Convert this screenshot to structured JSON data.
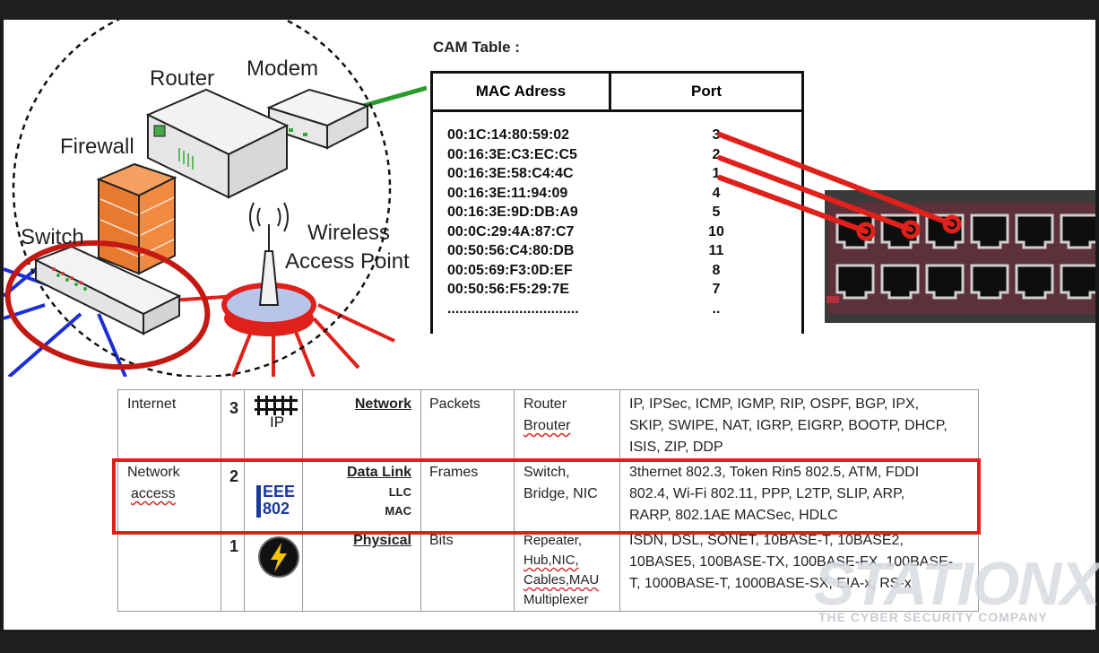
{
  "network_diagram": {
    "labels": {
      "router": "Router",
      "modem": "Modem",
      "firewall": "Firewall",
      "switch": "Switch",
      "wireless_line1": "Wireless",
      "wireless_line2": "Access Point"
    }
  },
  "cam_table": {
    "title": "CAM Table :",
    "headers": {
      "mac": "MAC Adress",
      "port": "Port"
    },
    "rows": [
      {
        "mac": "00:1C:14:80:59:02",
        "port": "3"
      },
      {
        "mac": "00:16:3E:C3:EC:C5",
        "port": "2"
      },
      {
        "mac": "00:16:3E:58:C4:4C",
        "port": "1"
      },
      {
        "mac": "00:16:3E:11:94:09",
        "port": "4"
      },
      {
        "mac": "00:16:3E:9D:DB:A9",
        "port": "5"
      },
      {
        "mac": "00:0C:29:4A:87:C7",
        "port": "10"
      },
      {
        "mac": "00:50:56:C4:80:DB",
        "port": "11"
      },
      {
        "mac": "00:05:69:F3:0D:EF",
        "port": "8"
      },
      {
        "mac": "00:50:56:F5:29:7E",
        "port": "7"
      },
      {
        "mac": ".................................",
        "port": ".."
      }
    ]
  },
  "osi_table": {
    "rows": [
      {
        "tcpip_layer": "Internet",
        "number": "3",
        "icon_text": "IP",
        "name": "Network",
        "pdu": "Packets",
        "devices": [
          "Router",
          "Brouter"
        ],
        "protocols": [
          "IP, IPSec, ICMP, IGMP, RIP, OSPF, BGP, IPX,",
          "SKIP, SWIPE, NAT, IGRP, EIGRP, BOOTP, DHCP,",
          "ISIS, ZIP, DDP"
        ]
      },
      {
        "tcpip_layer": [
          "Network",
          "access"
        ],
        "number": "2",
        "icon_text": [
          "EEE",
          "802"
        ],
        "name": "Data Link",
        "sublayers": [
          "LLC",
          "MAC"
        ],
        "pdu": "Frames",
        "devices": [
          "Switch,",
          "Bridge, NIC"
        ],
        "protocols": [
          "3thernet 802.3, Token Rin5 802.5, ATM, FDDI",
          "802.4, Wi-Fi 802.11, PPP, L2TP, SLIP, ARP,",
          "RARP, 802.1AE MACSec, HDLC"
        ]
      },
      {
        "number": "1",
        "name": "Physical",
        "pdu": "Bits",
        "devices": [
          "Repeater,",
          "Hub,NIC,",
          "Cables,MAU",
          "Multiplexer"
        ],
        "protocols": [
          "ISDN, DSL, SONET, 10BASE-T, 10BASE2,",
          "10BASE5, 100BASE-TX, 100BASE-FX, 100BASE-",
          "T, 1000BASE-T, 1000BASE-SX, EIA-x, RS-x"
        ]
      }
    ]
  },
  "watermark": {
    "logo": "STATIONX",
    "tagline": "THE CYBER SECURITY COMPANY"
  },
  "colors": {
    "highlight_red": "#e0201a",
    "link_green": "#2a9a2a",
    "link_blue": "#1a2fd6",
    "link_red": "#e0201a"
  }
}
